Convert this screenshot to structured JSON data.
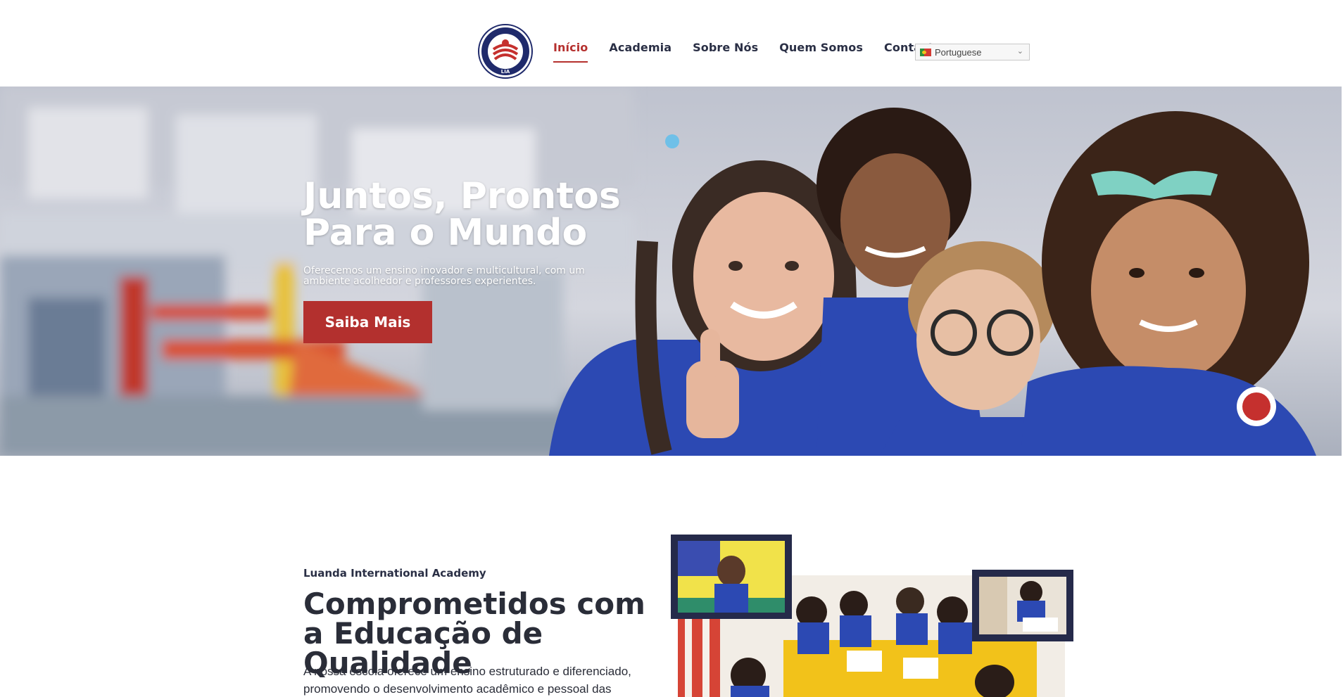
{
  "header": {
    "logo_text": "LIA",
    "nav": [
      {
        "label": "Início",
        "active": true
      },
      {
        "label": "Academia",
        "active": false
      },
      {
        "label": "Sobre Nós",
        "active": false
      },
      {
        "label": "Quem Somos",
        "active": false
      },
      {
        "label": "Contacto",
        "active": false
      }
    ],
    "language": {
      "selected": "Portuguese",
      "icon": "portugal-flag-icon"
    }
  },
  "hero": {
    "title": "Juntos, Prontos Para o Mundo",
    "subtitle": "Oferecemos um ensino inovador e multicultural, com um ambiente acolhedor e professores experientes.",
    "button_label": "Saiba Mais"
  },
  "about": {
    "kicker": "Luanda International Academy",
    "title": "Comprometidos com a Educação de Qualidade",
    "body": "A nossa escola oferece um ensino estruturado e diferenciado, promovendo o desenvolvimento acadêmico e pessoal das"
  },
  "colors": {
    "brand_red": "#b3302e",
    "brand_navy": "#252a4a",
    "uniform_blue": "#2c49b3"
  }
}
